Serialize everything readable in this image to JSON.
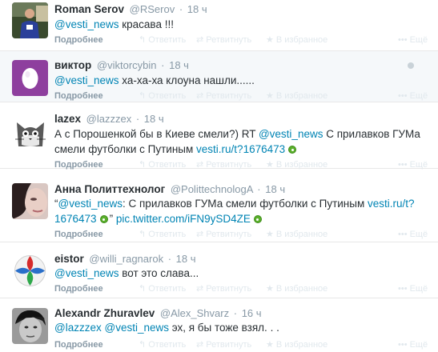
{
  "actions": {
    "expand": "Подробнее",
    "reply": "Ответить",
    "retweet": "Ретвитнуть",
    "favorite": "В избранное",
    "more": "Ещё"
  },
  "colors": {
    "link": "#0084b4",
    "meta": "#8899a6",
    "card_icon": "#5bb02c",
    "divider": "#e8e8e8"
  },
  "tweets": [
    {
      "fullname": "Roman Serov",
      "username": "@RSerov",
      "time": "18 ч",
      "avatar_icon": "photo-person-avatar",
      "text": [
        {
          "t": "@vesti_news",
          "k": "mention"
        },
        {
          "t": " красава !!!",
          "k": "text"
        }
      ]
    },
    {
      "fullname": "виктор",
      "username": "@viktorcybin",
      "time": "18 ч",
      "avatar_icon": "default-egg-avatar",
      "text": [
        {
          "t": "@vesti_news",
          "k": "mention"
        },
        {
          "t": " ха-ха-ха клоуна нашли......",
          "k": "text"
        }
      ]
    },
    {
      "fullname": "lazex",
      "username": "@lazzzex",
      "time": "18 ч",
      "avatar_icon": "cartoon-cat-avatar",
      "text": [
        {
          "t": "А с Порошенкой бы в Киеве смели?) RT ",
          "k": "text"
        },
        {
          "t": "@vesti_news",
          "k": "mention"
        },
        {
          "t": " С прилавков ГУМа смели футболки с Путиным ",
          "k": "text"
        },
        {
          "t": "vesti.ru/t?1676473",
          "k": "link"
        },
        {
          "t": "",
          "k": "card"
        }
      ]
    },
    {
      "fullname": "Анна Политтехнолог",
      "username": "@PolittechnologA",
      "time": "18 ч",
      "avatar_icon": "woman-face-avatar",
      "text": [
        {
          "t": "“",
          "k": "text"
        },
        {
          "t": "@vesti_news",
          "k": "mention"
        },
        {
          "t": ": С прилавков ГУМа смели футболки с Путиным ",
          "k": "text"
        },
        {
          "t": "vesti.ru/t?1676473",
          "k": "link"
        },
        {
          "t": "",
          "k": "card"
        },
        {
          "t": "” ",
          "k": "text"
        },
        {
          "t": "pic.twitter.com/iFN9ySD4ZE",
          "k": "link"
        },
        {
          "t": "",
          "k": "card"
        }
      ]
    },
    {
      "fullname": "eistor",
      "username": "@willi_ragnarok",
      "time": "18 ч",
      "avatar_icon": "ball-logo-avatar",
      "text": [
        {
          "t": "@vesti_news",
          "k": "mention"
        },
        {
          "t": " вот это слава...",
          "k": "text"
        }
      ]
    },
    {
      "fullname": "Alexandr Zhuravlev",
      "username": "@Alex_Shvarz",
      "time": "16 ч",
      "avatar_icon": "bw-face-avatar",
      "text": [
        {
          "t": "@lazzzex",
          "k": "mention"
        },
        {
          "t": " ",
          "k": "text"
        },
        {
          "t": "@vesti_news",
          "k": "mention"
        },
        {
          "t": " эх, я бы тоже взял. . .",
          "k": "text"
        }
      ]
    }
  ]
}
